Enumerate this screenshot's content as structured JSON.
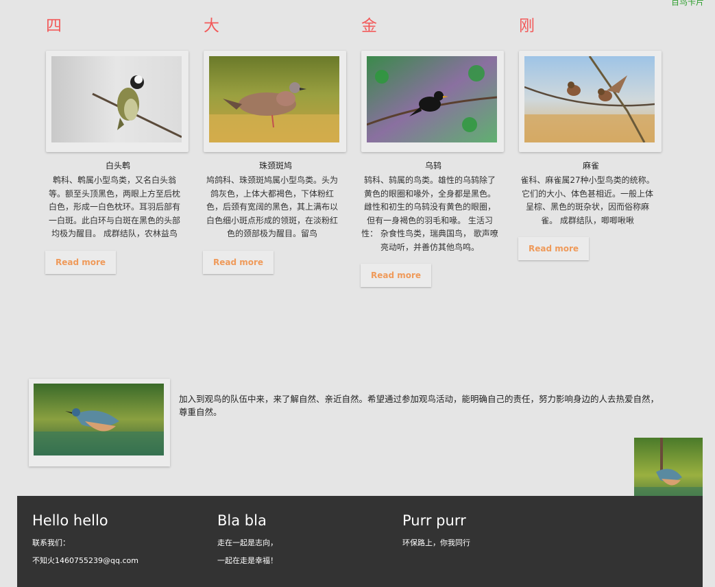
{
  "top_link": "百鸟卡片",
  "columns": [
    {
      "title": "四",
      "name": "白头鹎",
      "desc": "鹎科、鹎属小型鸟类，又名白头翁等。额至头顶黑色，两眼上方至后枕白色，形成一白色枕环。耳羽后部有一白斑。此白环与白斑在黑色的头部均极为醒目。 成群结队，农林益鸟",
      "read_more": "Read more"
    },
    {
      "title": "大",
      "name": "珠颈斑鸠",
      "desc": "鸠鸽科、珠颈斑鸠属小型鸟类。头为鸽灰色，上体大都褐色，下体粉红色，后颈有宽阔的黑色，其上满布以白色细小斑点形成的领斑，在淡粉红色的颈部极为醒目。留鸟",
      "read_more": "Read more"
    },
    {
      "title": "金",
      "name": "乌鸫",
      "desc": "鸫科、鸫属的鸟类。雄性的乌鸫除了黄色的眼圈和喙外，全身都是黑色。雌性和初生的乌鸫没有黄色的眼圈，但有一身褐色的羽毛和喙。 生活习性： 杂食性鸟类，瑞典国鸟， 歌声嘹亮动听，并善仿其他鸟鸣。",
      "read_more": "Read more"
    },
    {
      "title": "刚",
      "name": "麻雀",
      "desc": "雀科、麻雀属27种小型鸟类的统称。它们的大小、体色甚相近。一般上体呈棕、黑色的斑杂状，因而俗称麻雀。 成群结队，唧唧啾啾",
      "read_more": "Read more"
    }
  ],
  "join": {
    "text": "加入到观鸟的队伍中来，来了解自然、亲近自然。希望通过参加观鸟活动，能明确自己的责任，努力影响身边的人去热爱自然，尊重自然。"
  },
  "footer": {
    "col1": {
      "title": "Hello hello",
      "line1": "联系我们：",
      "line2": "不知火1460755239@qq.com"
    },
    "col2": {
      "title": "Bla bla",
      "line1": "走在一起是志向，",
      "line2": "一起在走是幸福！"
    },
    "col3": {
      "title": "Purr purr",
      "line1": "环保路上，你我同行"
    }
  },
  "colors": {
    "title_red": "#f25a5a",
    "read_more_orange": "#ef9a5a",
    "footer_bg": "#333333",
    "page_bg": "#e5e5e5"
  }
}
